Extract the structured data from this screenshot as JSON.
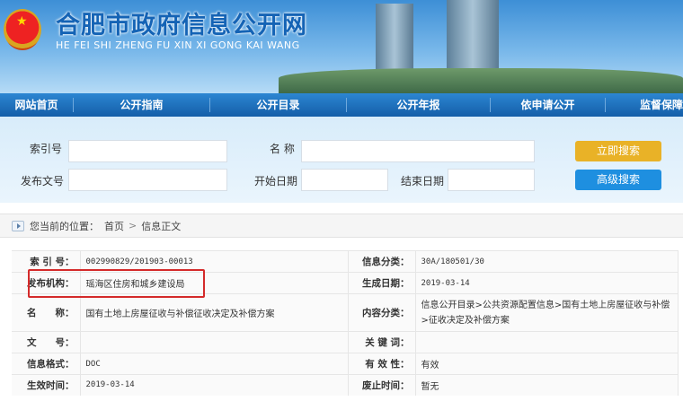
{
  "header": {
    "title": "合肥市政府信息公开网",
    "subtitle": "HE FEI SHI ZHENG FU XIN XI GONG KAI WANG"
  },
  "nav": [
    "网站首页",
    "公开指南",
    "公开目录",
    "公开年报",
    "依申请公开",
    "监督保障"
  ],
  "search": {
    "index_label": "索引号",
    "name_label": "名 称",
    "doc_label": "发布文号",
    "start_label": "开始日期",
    "end_label": "结束日期",
    "search_button": "立即搜索",
    "advanced_button": "高级搜索"
  },
  "breadcrumb": {
    "prefix": "您当前的位置：",
    "home": "首页",
    "sep": ">",
    "current": "信息正文"
  },
  "info": {
    "index_label": "索 引 号：",
    "index_value": "002990829/201903-00013",
    "category_label": "信息分类：",
    "category_value": "30A/180501/30",
    "publisher_label": "发布机构：",
    "publisher_value": "瑶海区住房和城乡建设局",
    "created_label": "生成日期：",
    "created_value": "2019-03-14",
    "name_label": "名　　称：",
    "name_value": "国有土地上房屋征收与补偿征收决定及补偿方案",
    "content_label": "内容分类：",
    "content_value": "信息公开目录>公共资源配置信息>国有土地上房屋征收与补偿>征收决定及补偿方案",
    "docno_label": "文　　号：",
    "docno_value": "",
    "keyword_label": "关 键 词：",
    "keyword_value": "",
    "format_label": "信息格式：",
    "format_value": "DOC",
    "validity_label": "有 效 性：",
    "validity_value": "有效",
    "effective_label": "生效时间：",
    "effective_value": "2019-03-14",
    "abolish_label": "废止时间：",
    "abolish_value": "暂无"
  },
  "colors": {
    "nav": "#1d6fbf",
    "search_btn": "#e9b227",
    "advanced_btn": "#1e8fe0",
    "highlight": "#d42a2a"
  }
}
